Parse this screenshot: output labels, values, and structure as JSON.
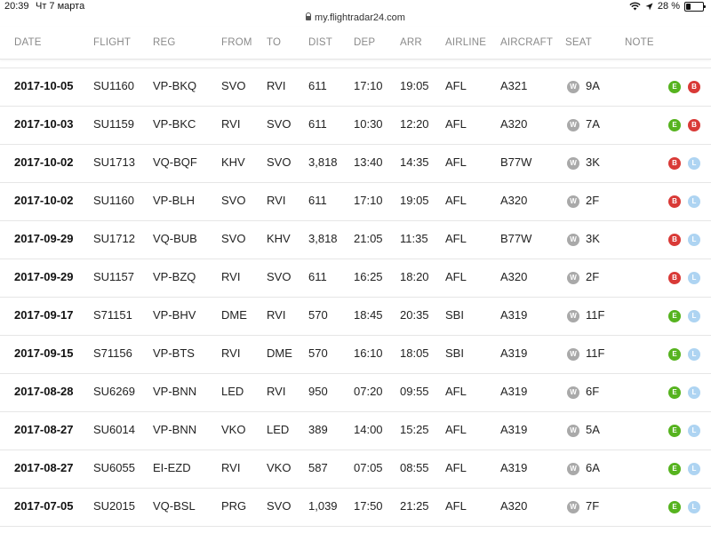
{
  "status_bar": {
    "time": "20:39",
    "date": "Чт 7 марта",
    "battery": "28 %",
    "battery_level": 0.28
  },
  "url": "my.flightradar24.com",
  "columns": {
    "date": "DATE",
    "flight": "FLIGHT",
    "reg": "REG",
    "from": "FROM",
    "to": "TO",
    "dist": "DIST",
    "dep": "DEP",
    "arr": "ARR",
    "airline": "AIRLINE",
    "aircraft": "AIRCRAFT",
    "seat": "SEAT",
    "note": "NOTE"
  },
  "colors": {
    "economy": "#56b31f",
    "business": "#d93a37",
    "leisure": "#aed4f2",
    "window": "#a9a9a9"
  },
  "rows": [
    {
      "date": "2017-10-05",
      "flight": "SU1160",
      "reg": "VP-BKQ",
      "from": "SVO",
      "to": "RVI",
      "dist": "611",
      "dep": "17:10",
      "arr": "19:05",
      "airline": "AFL",
      "aircraft": "A321",
      "seat_type": "W",
      "seat": "9A",
      "badge1": "E",
      "badge2": "B"
    },
    {
      "date": "2017-10-03",
      "flight": "SU1159",
      "reg": "VP-BKC",
      "from": "RVI",
      "to": "SVO",
      "dist": "611",
      "dep": "10:30",
      "arr": "12:20",
      "airline": "AFL",
      "aircraft": "A320",
      "seat_type": "W",
      "seat": "7A",
      "badge1": "E",
      "badge2": "B"
    },
    {
      "date": "2017-10-02",
      "flight": "SU1713",
      "reg": "VQ-BQF",
      "from": "KHV",
      "to": "SVO",
      "dist": "3,818",
      "dep": "13:40",
      "arr": "14:35",
      "airline": "AFL",
      "aircraft": "B77W",
      "seat_type": "W",
      "seat": "3K",
      "badge1": "B",
      "badge2": "L"
    },
    {
      "date": "2017-10-02",
      "flight": "SU1160",
      "reg": "VP-BLH",
      "from": "SVO",
      "to": "RVI",
      "dist": "611",
      "dep": "17:10",
      "arr": "19:05",
      "airline": "AFL",
      "aircraft": "A320",
      "seat_type": "W",
      "seat": "2F",
      "badge1": "B",
      "badge2": "L"
    },
    {
      "date": "2017-09-29",
      "flight": "SU1712",
      "reg": "VQ-BUB",
      "from": "SVO",
      "to": "KHV",
      "dist": "3,818",
      "dep": "21:05",
      "arr": "11:35",
      "airline": "AFL",
      "aircraft": "B77W",
      "seat_type": "W",
      "seat": "3K",
      "badge1": "B",
      "badge2": "L"
    },
    {
      "date": "2017-09-29",
      "flight": "SU1157",
      "reg": "VP-BZQ",
      "from": "RVI",
      "to": "SVO",
      "dist": "611",
      "dep": "16:25",
      "arr": "18:20",
      "airline": "AFL",
      "aircraft": "A320",
      "seat_type": "W",
      "seat": "2F",
      "badge1": "B",
      "badge2": "L"
    },
    {
      "date": "2017-09-17",
      "flight": "S71151",
      "reg": "VP-BHV",
      "from": "DME",
      "to": "RVI",
      "dist": "570",
      "dep": "18:45",
      "arr": "20:35",
      "airline": "SBI",
      "aircraft": "A319",
      "seat_type": "W",
      "seat": "11F",
      "badge1": "E",
      "badge2": "L"
    },
    {
      "date": "2017-09-15",
      "flight": "S71156",
      "reg": "VP-BTS",
      "from": "RVI",
      "to": "DME",
      "dist": "570",
      "dep": "16:10",
      "arr": "18:05",
      "airline": "SBI",
      "aircraft": "A319",
      "seat_type": "W",
      "seat": "11F",
      "badge1": "E",
      "badge2": "L"
    },
    {
      "date": "2017-08-28",
      "flight": "SU6269",
      "reg": "VP-BNN",
      "from": "LED",
      "to": "RVI",
      "dist": "950",
      "dep": "07:20",
      "arr": "09:55",
      "airline": "AFL",
      "aircraft": "A319",
      "seat_type": "W",
      "seat": "6F",
      "badge1": "E",
      "badge2": "L"
    },
    {
      "date": "2017-08-27",
      "flight": "SU6014",
      "reg": "VP-BNN",
      "from": "VKO",
      "to": "LED",
      "dist": "389",
      "dep": "14:00",
      "arr": "15:25",
      "airline": "AFL",
      "aircraft": "A319",
      "seat_type": "W",
      "seat": "5A",
      "badge1": "E",
      "badge2": "L"
    },
    {
      "date": "2017-08-27",
      "flight": "SU6055",
      "reg": "EI-EZD",
      "from": "RVI",
      "to": "VKO",
      "dist": "587",
      "dep": "07:05",
      "arr": "08:55",
      "airline": "AFL",
      "aircraft": "A319",
      "seat_type": "W",
      "seat": "6A",
      "badge1": "E",
      "badge2": "L"
    },
    {
      "date": "2017-07-05",
      "flight": "SU2015",
      "reg": "VQ-BSL",
      "from": "PRG",
      "to": "SVO",
      "dist": "1,039",
      "dep": "17:50",
      "arr": "21:25",
      "airline": "AFL",
      "aircraft": "A320",
      "seat_type": "W",
      "seat": "7F",
      "badge1": "E",
      "badge2": "L"
    }
  ]
}
